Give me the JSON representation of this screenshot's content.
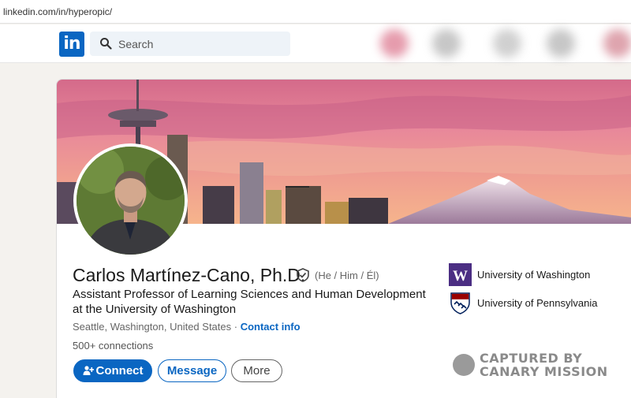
{
  "browser": {
    "url": "linkedin.com/in/hyperopic/"
  },
  "nav": {
    "logo_text": "in",
    "search_placeholder": "Search"
  },
  "profile": {
    "name": "Carlos Martínez-Cano, Ph.D.",
    "pronouns": "(He / Him / Él)",
    "headline": "Assistant Professor of Learning Sciences and Human Development at the University of Washington",
    "location": "Seattle, Washington, United States",
    "location_sep": " · ",
    "contact_link": "Contact info",
    "connections": "500+ connections"
  },
  "actions": {
    "connect": "Connect",
    "message": "Message",
    "more": "More"
  },
  "organizations": [
    {
      "name": "University of Washington",
      "color": "#4b2e83",
      "logo_letter": "W"
    },
    {
      "name": "University of Pennsylvania",
      "color": "#011f5b"
    }
  ],
  "watermark": {
    "line1": "CAPTURED BY",
    "line2": "CANARY MISSION"
  },
  "colors": {
    "brand": "#0a66c2",
    "page_bg": "#f4f2ee"
  }
}
